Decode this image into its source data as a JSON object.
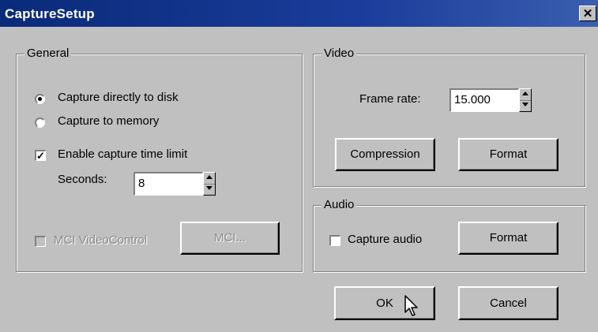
{
  "window": {
    "title": "CaptureSetup",
    "close_glyph": "✕"
  },
  "general": {
    "legend": "General",
    "radio_disk_label": "Capture directly to disk",
    "radio_memory_label": "Capture to memory",
    "selected_capture_mode": "disk",
    "time_limit_label": "Enable capture time limit",
    "time_limit_checked": true,
    "time_limit_mark": "✓",
    "seconds_label": "Seconds:",
    "seconds_value": "8",
    "mci_videocontrol_label": "MCI VideoControl",
    "mci_videocontrol_checked": false,
    "mci_button_label": "MCI..."
  },
  "video": {
    "legend": "Video",
    "frame_rate_label": "Frame rate:",
    "frame_rate_value": "15.000",
    "compression_button_label": "Compression",
    "format_button_label": "Format"
  },
  "audio": {
    "legend": "Audio",
    "capture_audio_label": "Capture audio",
    "capture_audio_checked": false,
    "format_button_label": "Format"
  },
  "buttons": {
    "ok_label": "OK",
    "cancel_label": "Cancel"
  },
  "icons": {
    "cursor": "arrow-cursor-icon",
    "close": "close-icon",
    "spin": "spin-up-down-icon"
  }
}
